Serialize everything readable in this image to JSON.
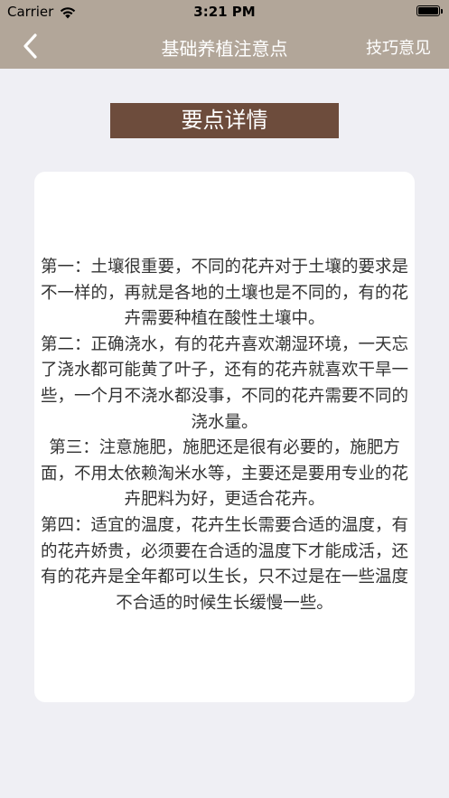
{
  "status_bar": {
    "carrier": "Carrier",
    "time": "3:21 PM",
    "wifi_icon": "wifi-icon",
    "battery_icon": "battery-icon"
  },
  "nav": {
    "back_icon": "chevron-left-icon",
    "title": "基础养植注意点",
    "right_label": "技巧意见"
  },
  "header": {
    "title": "要点详情"
  },
  "content": {
    "paragraphs": [
      "第一：土壤很重要，不同的花卉对于土壤的要求是不一样的，再就是各地的土壤也是不同的，有的花卉需要种植在酸性土壤中。",
      "第二：正确浇水，有的花卉喜欢潮湿环境，一天忘了浇水都可能黄了叶子，还有的花卉就喜欢干旱一些，一个月不浇水都没事，不同的花卉需要不同的浇水量。",
      "第三：注意施肥，施肥还是很有必要的，施肥方面，不用太依赖淘米水等，主要还是要用专业的花卉肥料为好，更适合花卉。",
      "第四：适宜的温度，花卉生长需要合适的温度，有的花卉娇贵，必须要在合适的温度下才能成活，还有的花卉是全年都可以生长，只不过是在一些温度不合适的时候生长缓慢一些。"
    ]
  },
  "colors": {
    "nav_bg": "#b2a699",
    "header_bg": "#6d4c3c",
    "page_bg": "#efeff4",
    "card_bg": "#ffffff"
  }
}
